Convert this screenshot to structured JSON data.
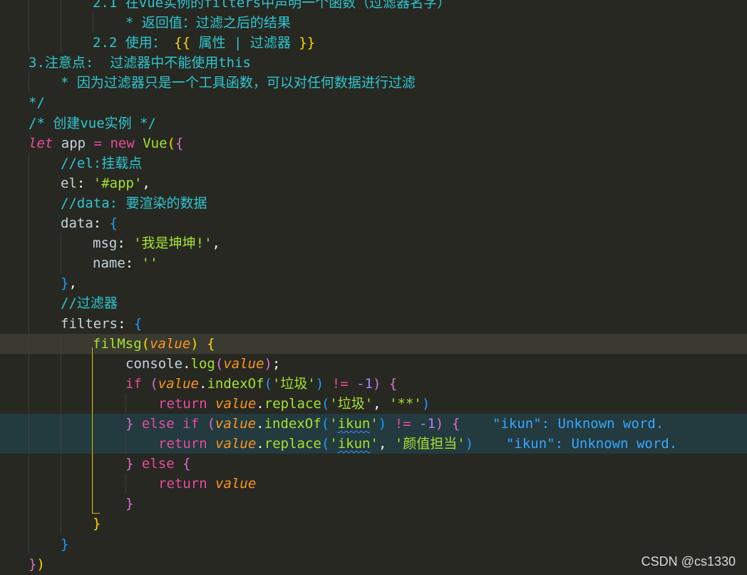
{
  "editor": {
    "lines": [
      {
        "indent": 2,
        "tokens": [
          {
            "t": "2.1 在vue实例的filters中声明一个函数（过滤器名字）",
            "c": "cm"
          }
        ]
      },
      {
        "indent": 3,
        "tokens": [
          {
            "t": "* 返回值：过滤之后的结果",
            "c": "cm"
          }
        ]
      },
      {
        "indent": 2,
        "tokens": [
          {
            "t": "2.2 使用： ",
            "c": "cm"
          },
          {
            "t": "{{",
            "c": "br1"
          },
          {
            "t": " 属性 | 过滤器 ",
            "c": "cm"
          },
          {
            "t": "}}",
            "c": "br1"
          }
        ]
      },
      {
        "indent": 0,
        "tokens": [
          {
            "t": "3.注意点:  过滤器中不能使用this",
            "c": "cm"
          }
        ]
      },
      {
        "indent": 1,
        "tokens": [
          {
            "t": "* 因为过滤器只是一个工具函数，可以对任何数据进行过滤",
            "c": "cm"
          }
        ]
      },
      {
        "indent": 0,
        "tokens": [
          {
            "t": "*/",
            "c": "cm"
          }
        ]
      },
      {
        "indent": 0,
        "tokens": [
          {
            "t": "/* 创建vue实例 */",
            "c": "cm"
          }
        ]
      },
      {
        "indent": 0,
        "tokens": [
          {
            "t": "let",
            "c": "kw it"
          },
          {
            "t": " app ",
            "c": "var"
          },
          {
            "t": "=",
            "c": "kw"
          },
          {
            "t": " ",
            "c": "pun"
          },
          {
            "t": "new",
            "c": "kw"
          },
          {
            "t": " ",
            "c": "pun"
          },
          {
            "t": "Vue",
            "c": "fn"
          },
          {
            "t": "(",
            "c": "br1"
          },
          {
            "t": "{",
            "c": "br2"
          }
        ]
      },
      {
        "indent": 1,
        "tokens": [
          {
            "t": "//el:挂载点",
            "c": "cm"
          }
        ]
      },
      {
        "indent": 1,
        "tokens": [
          {
            "t": "el",
            "c": "var"
          },
          {
            "t": ": ",
            "c": "pun"
          },
          {
            "t": "'#app'",
            "c": "strgreen"
          },
          {
            "t": ",",
            "c": "pun"
          }
        ]
      },
      {
        "indent": 1,
        "tokens": [
          {
            "t": "//data: 要渲染的数据",
            "c": "cm"
          }
        ]
      },
      {
        "indent": 1,
        "tokens": [
          {
            "t": "data",
            "c": "var"
          },
          {
            "t": ": ",
            "c": "pun"
          },
          {
            "t": "{",
            "c": "br3"
          }
        ]
      },
      {
        "indent": 2,
        "tokens": [
          {
            "t": "msg",
            "c": "var"
          },
          {
            "t": ": ",
            "c": "pun"
          },
          {
            "t": "'我是坤坤!'",
            "c": "strgreen"
          },
          {
            "t": ",",
            "c": "pun"
          }
        ]
      },
      {
        "indent": 2,
        "tokens": [
          {
            "t": "name",
            "c": "var"
          },
          {
            "t": ": ",
            "c": "pun"
          },
          {
            "t": "''",
            "c": "strgreen"
          }
        ]
      },
      {
        "indent": 1,
        "tokens": [
          {
            "t": "}",
            "c": "br3"
          },
          {
            "t": ",",
            "c": "pun"
          }
        ]
      },
      {
        "indent": 1,
        "tokens": [
          {
            "t": "//过滤器",
            "c": "cm"
          }
        ]
      },
      {
        "indent": 1,
        "tokens": [
          {
            "t": "filters",
            "c": "var"
          },
          {
            "t": ": ",
            "c": "pun"
          },
          {
            "t": "{",
            "c": "br3"
          }
        ]
      },
      {
        "indent": 2,
        "cls": "cur",
        "tokens": [
          {
            "t": "filMsg",
            "c": "fn"
          },
          {
            "t": "(",
            "c": "br1"
          },
          {
            "t": "value",
            "c": "prm"
          },
          {
            "t": ")",
            "c": "br1"
          },
          {
            "t": " ",
            "c": "pun"
          },
          {
            "t": "{",
            "c": "br1"
          }
        ]
      },
      {
        "indent": 3,
        "tokens": [
          {
            "t": "console",
            "c": "var"
          },
          {
            "t": ".",
            "c": "pun"
          },
          {
            "t": "log",
            "c": "fn"
          },
          {
            "t": "(",
            "c": "br2"
          },
          {
            "t": "value",
            "c": "prm"
          },
          {
            "t": ")",
            "c": "br2"
          },
          {
            "t": ";",
            "c": "pun"
          }
        ]
      },
      {
        "indent": 3,
        "tokens": [
          {
            "t": "if",
            "c": "kw"
          },
          {
            "t": " ",
            "c": "pun"
          },
          {
            "t": "(",
            "c": "br2"
          },
          {
            "t": "value",
            "c": "prm"
          },
          {
            "t": ".",
            "c": "pun"
          },
          {
            "t": "indexOf",
            "c": "fn"
          },
          {
            "t": "(",
            "c": "br3"
          },
          {
            "t": "'垃圾'",
            "c": "strgreen"
          },
          {
            "t": ")",
            "c": "br3"
          },
          {
            "t": " ",
            "c": "pun"
          },
          {
            "t": "!=",
            "c": "kw"
          },
          {
            "t": " ",
            "c": "pun"
          },
          {
            "t": "-1",
            "c": "num"
          },
          {
            "t": ")",
            "c": "br2"
          },
          {
            "t": " ",
            "c": "pun"
          },
          {
            "t": "{",
            "c": "br2"
          }
        ]
      },
      {
        "indent": 4,
        "tokens": [
          {
            "t": "return",
            "c": "kw"
          },
          {
            "t": " ",
            "c": "pun"
          },
          {
            "t": "value",
            "c": "prm"
          },
          {
            "t": ".",
            "c": "pun"
          },
          {
            "t": "replace",
            "c": "fn"
          },
          {
            "t": "(",
            "c": "br3"
          },
          {
            "t": "'垃圾'",
            "c": "strgreen"
          },
          {
            "t": ", ",
            "c": "pun"
          },
          {
            "t": "'**'",
            "c": "strgreen"
          },
          {
            "t": ")",
            "c": "br3"
          }
        ]
      },
      {
        "indent": 3,
        "cls": "diag",
        "tokens": [
          {
            "t": "}",
            "c": "br2"
          },
          {
            "t": " ",
            "c": "pun"
          },
          {
            "t": "else",
            "c": "kw"
          },
          {
            "t": " ",
            "c": "pun"
          },
          {
            "t": "if",
            "c": "kw"
          },
          {
            "t": " ",
            "c": "pun"
          },
          {
            "t": "(",
            "c": "br2"
          },
          {
            "t": "value",
            "c": "prm"
          },
          {
            "t": ".",
            "c": "pun"
          },
          {
            "t": "indexOf",
            "c": "fn"
          },
          {
            "t": "(",
            "c": "br3"
          },
          {
            "t": "'",
            "c": "strgreen"
          },
          {
            "t": "ikun",
            "c": "strgreen sq"
          },
          {
            "t": "'",
            "c": "strgreen"
          },
          {
            "t": ")",
            "c": "br3"
          },
          {
            "t": " ",
            "c": "pun"
          },
          {
            "t": "!=",
            "c": "kw"
          },
          {
            "t": " ",
            "c": "pun"
          },
          {
            "t": "-1",
            "c": "num"
          },
          {
            "t": ")",
            "c": "br2"
          },
          {
            "t": " ",
            "c": "pun"
          },
          {
            "t": "{",
            "c": "br2"
          },
          {
            "t": "    \"ikun\": Unknown word.",
            "c": "diagmsg"
          }
        ]
      },
      {
        "indent": 4,
        "cls": "diag",
        "tokens": [
          {
            "t": "return",
            "c": "kw"
          },
          {
            "t": " ",
            "c": "pun"
          },
          {
            "t": "value",
            "c": "prm"
          },
          {
            "t": ".",
            "c": "pun"
          },
          {
            "t": "replace",
            "c": "fn"
          },
          {
            "t": "(",
            "c": "br3"
          },
          {
            "t": "'",
            "c": "strgreen"
          },
          {
            "t": "ikun",
            "c": "strgreen sq"
          },
          {
            "t": "'",
            "c": "strgreen"
          },
          {
            "t": ", ",
            "c": "pun"
          },
          {
            "t": "'颜值担当'",
            "c": "strgreen"
          },
          {
            "t": ")",
            "c": "br3"
          },
          {
            "t": "    \"ikun\": Unknown word.",
            "c": "diagmsg"
          }
        ]
      },
      {
        "indent": 3,
        "tokens": [
          {
            "t": "}",
            "c": "br2"
          },
          {
            "t": " ",
            "c": "pun"
          },
          {
            "t": "else",
            "c": "kw"
          },
          {
            "t": " ",
            "c": "pun"
          },
          {
            "t": "{",
            "c": "br2"
          }
        ]
      },
      {
        "indent": 4,
        "tokens": [
          {
            "t": "return",
            "c": "kw"
          },
          {
            "t": " ",
            "c": "pun"
          },
          {
            "t": "value",
            "c": "prm"
          }
        ]
      },
      {
        "indent": 3,
        "tokens": [
          {
            "t": "}",
            "c": "br2"
          }
        ]
      },
      {
        "indent": 2,
        "tokens": [
          {
            "t": "}",
            "c": "br1"
          }
        ]
      },
      {
        "indent": 1,
        "tokens": [
          {
            "t": "}",
            "c": "br3"
          }
        ]
      },
      {
        "indent": 0,
        "tokens": [
          {
            "t": "}",
            "c": "br2"
          },
          {
            "t": ")",
            "c": "br1"
          }
        ]
      }
    ]
  },
  "watermark": "CSDN @cs1330"
}
